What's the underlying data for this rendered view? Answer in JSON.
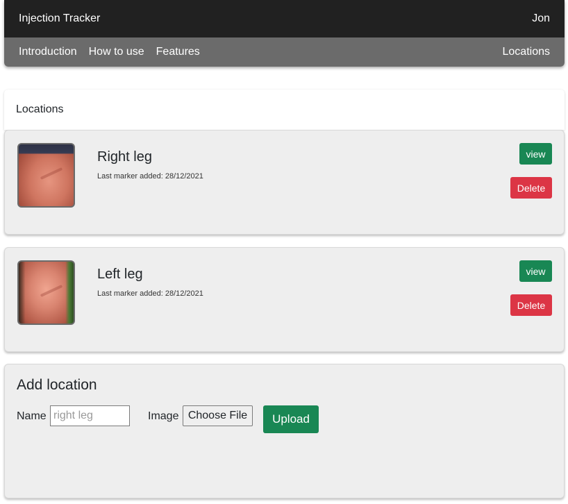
{
  "app": {
    "title": "Injection Tracker",
    "user": "Jon"
  },
  "subnav": {
    "links": [
      "Introduction",
      "How to use",
      "Features"
    ],
    "right": "Locations"
  },
  "locations_panel": {
    "heading": "Locations"
  },
  "locations": [
    {
      "name": "Right leg",
      "last_marker": "Last marker added: 28/12/2021",
      "view_label": "view",
      "delete_label": "Delete"
    },
    {
      "name": "Left leg",
      "last_marker": "Last marker added: 28/12/2021",
      "view_label": "view",
      "delete_label": "Delete"
    }
  ],
  "add_location": {
    "title": "Add location",
    "name_label": "Name",
    "name_placeholder": "right leg",
    "image_label": "Image",
    "file_button": "Choose File",
    "upload_label": "Upload"
  },
  "colors": {
    "topbar": "#212121",
    "subbar": "#6b6b6b",
    "success": "#198754",
    "danger": "#dc3545",
    "card_bg": "#eeeeee"
  }
}
